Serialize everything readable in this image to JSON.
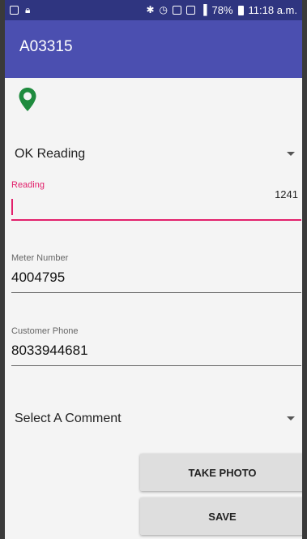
{
  "status_bar": {
    "time": "11:18 a.m.",
    "battery": "78%"
  },
  "app_bar": {
    "title": "A03315"
  },
  "colors": {
    "primary": "#4b4fb0",
    "status_bar": "#2f3580",
    "accent": "#e2206b",
    "location_icon": "#1f8b3e"
  },
  "status_spinner": {
    "selected": "OK Reading"
  },
  "reading_field": {
    "label": "Reading",
    "value": "",
    "counter": "1241"
  },
  "meter_field": {
    "label": "Meter Number",
    "value": "4004795"
  },
  "phone_field": {
    "label": "Customer Phone",
    "value": "8033944681"
  },
  "comment_spinner": {
    "selected": "Select A Comment"
  },
  "buttons": {
    "take_photo": "TAKE PHOTO",
    "save": "SAVE"
  }
}
